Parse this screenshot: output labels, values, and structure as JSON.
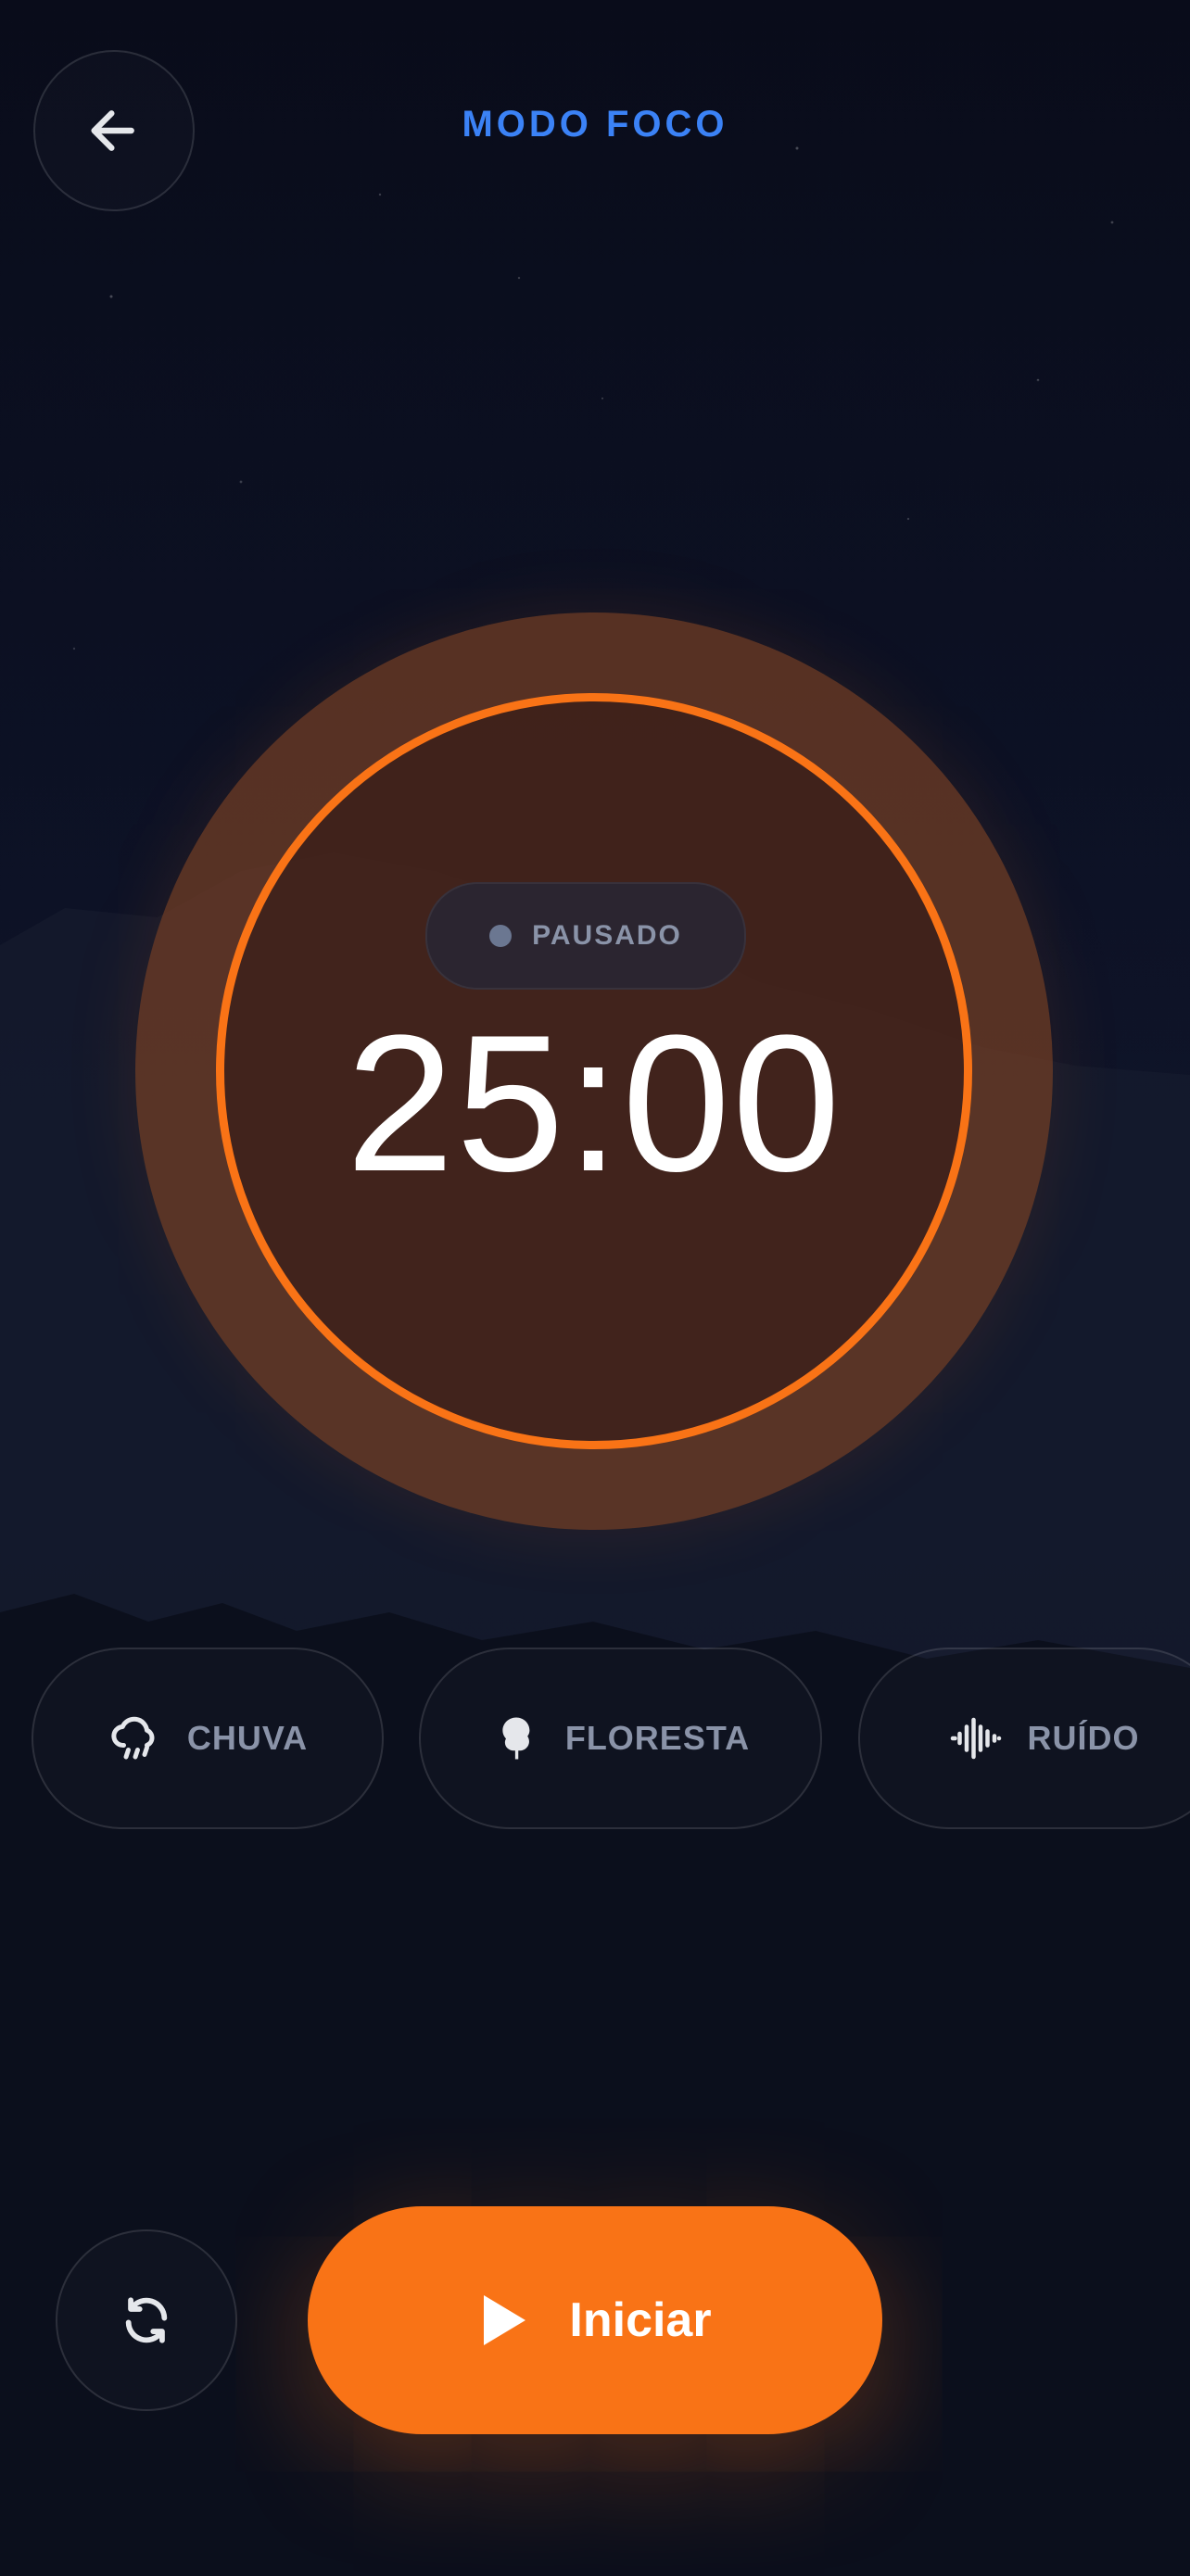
{
  "header": {
    "title": "MODO FOCO",
    "back_icon": "arrow-left-icon"
  },
  "timer": {
    "status": "PAUSADO",
    "time": "25:00",
    "accent_color": "#f97316"
  },
  "sounds": [
    {
      "label": "CHUVA",
      "icon": "rain-cloud-icon"
    },
    {
      "label": "FLORESTA",
      "icon": "tree-icon"
    },
    {
      "label": "RUÍDO",
      "icon": "sound-wave-icon"
    }
  ],
  "controls": {
    "reset_icon": "refresh-icon",
    "start_label": "Iniciar",
    "start_icon": "play-icon"
  },
  "colors": {
    "accent": "#f97316",
    "title": "#3b82f6",
    "background": "#0d1226"
  }
}
